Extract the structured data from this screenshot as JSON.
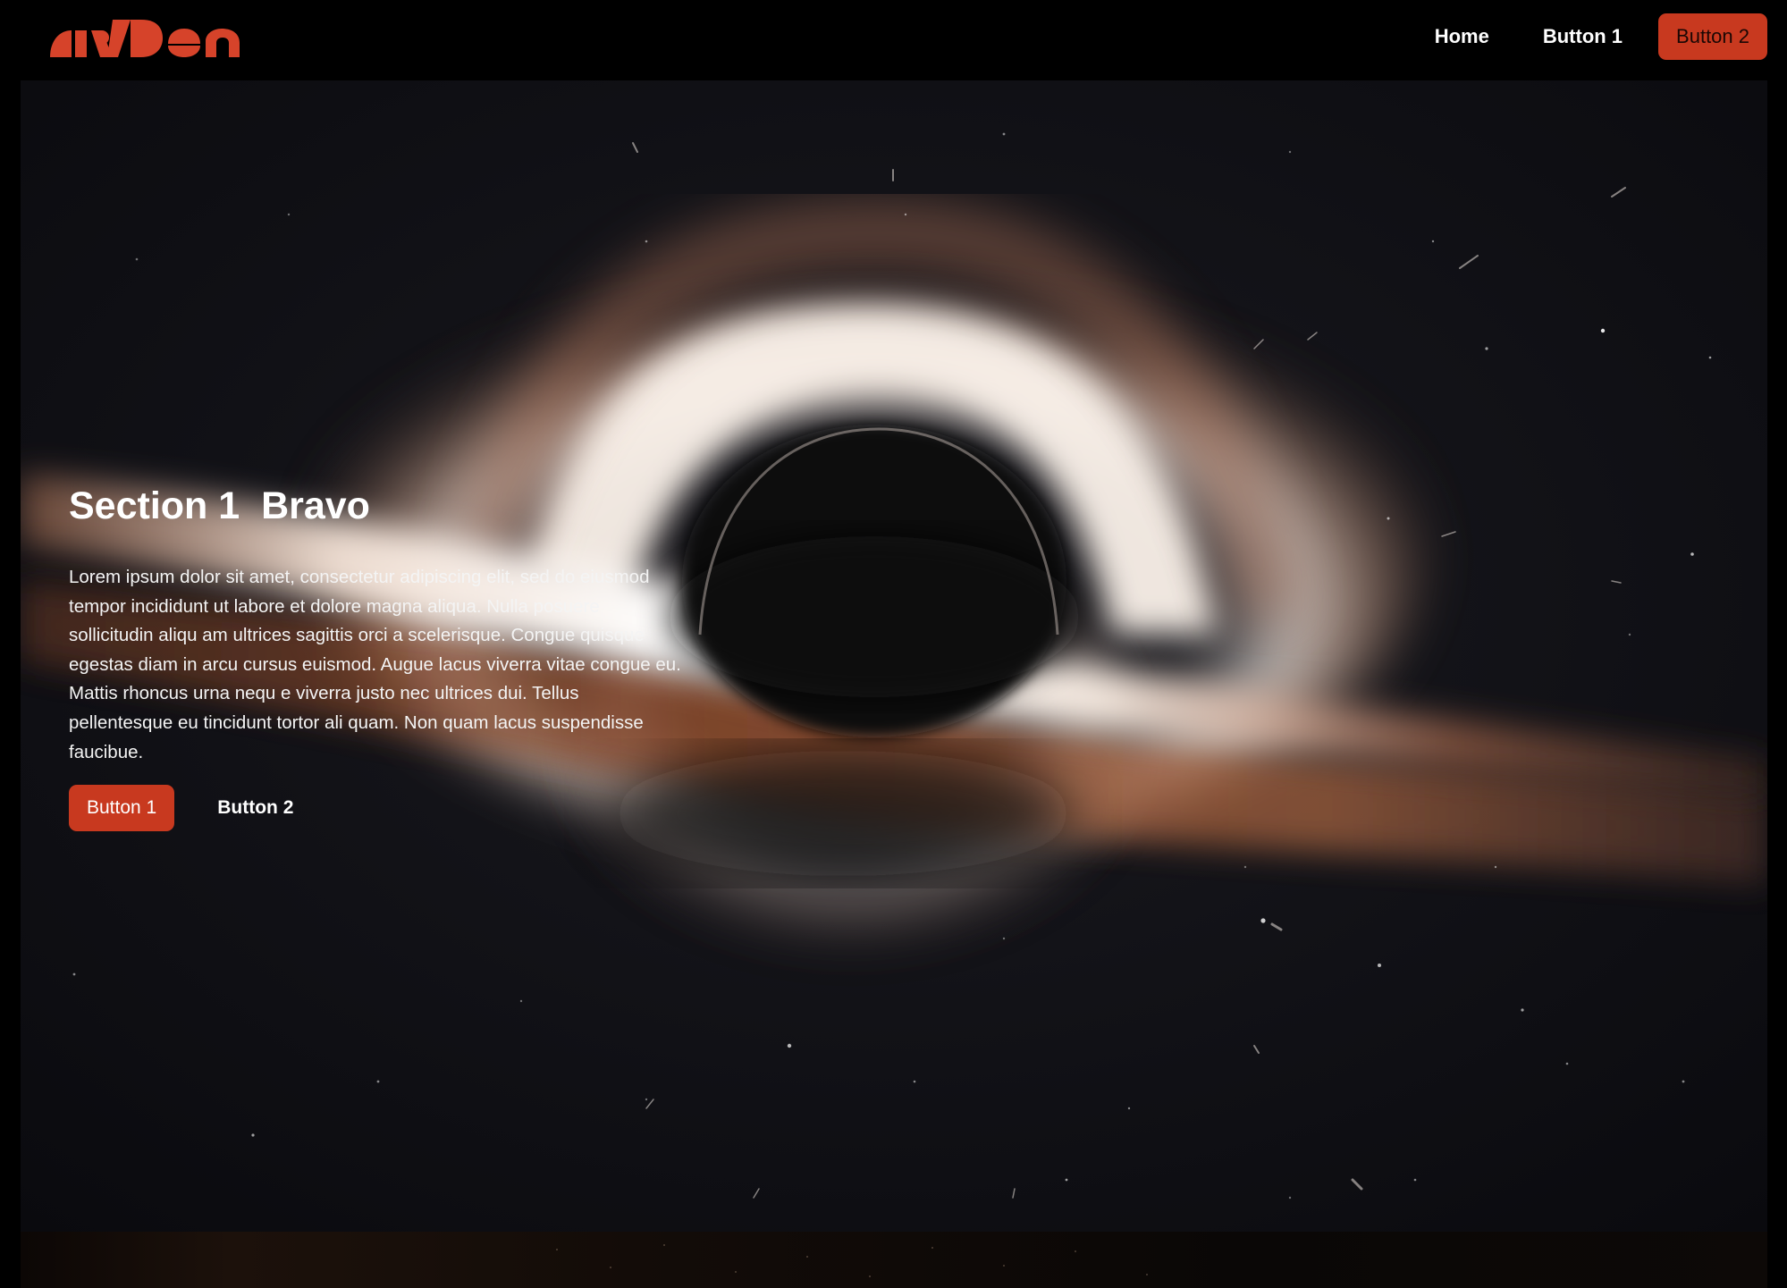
{
  "navbar": {
    "logo_text": "AYDEN",
    "links": {
      "home": "Home",
      "button_1": "Button 1",
      "button_2": "Button 2"
    }
  },
  "hero": {
    "title": "Section 1  Bravo",
    "body": "Lorem ipsum dolor sit amet, consectetur adipiscing elit, sed do eiusmod tempor incididunt ut labore et dolore magna aliqua. Nulla posuere sollicitudin aliqu am ultrices sagittis orci a scelerisque. Congue quisque egestas diam in arcu cursus euismod. Augue lacus viverra vitae congue eu. Mattis rhoncus urna nequ e viverra justo nec ultrices dui. Tellus pellentesque eu tincidunt tortor ali quam. Non quam lacus suspendisse faucibue.",
    "buttons": {
      "primary": "Button 1",
      "secondary": "Button 2"
    },
    "background": "black-hole-image"
  },
  "colors": {
    "accent": "#c8391f",
    "nav_background": "#000000",
    "text": "#ffffff"
  }
}
